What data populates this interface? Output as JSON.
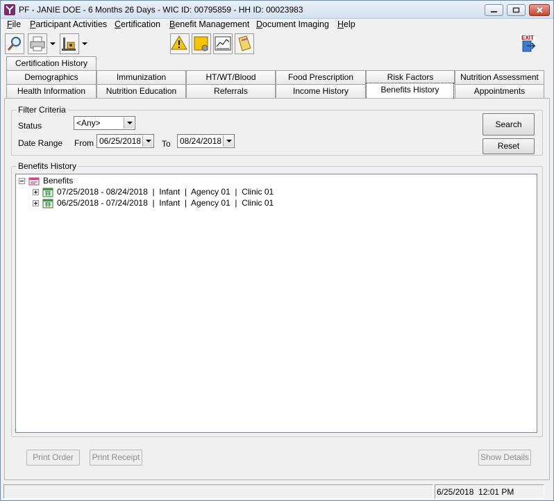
{
  "window": {
    "title": "PF - JANIE DOE - 6 Months 26 Days - WIC ID: 00795859 - HH ID: 00023983",
    "controls": [
      "minimize",
      "maximize",
      "close"
    ]
  },
  "menu": {
    "items": [
      {
        "label": "File",
        "mnemonic": "F",
        "rest": "ile"
      },
      {
        "label": "Participant Activities",
        "mnemonic": "P",
        "rest": "articipant Activities"
      },
      {
        "label": "Certification",
        "mnemonic": "C",
        "rest": "ertification"
      },
      {
        "label": "Benefit Management",
        "mnemonic": "B",
        "rest": "enefit Management"
      },
      {
        "label": "Document Imaging",
        "mnemonic": "D",
        "rest": "ocument Imaging"
      },
      {
        "label": "Help",
        "mnemonic": "H",
        "rest": "elp"
      }
    ]
  },
  "toolbar": {
    "icons": [
      "search-icon",
      "printer-icon",
      "scale-icon",
      "alert-icon",
      "note-icon",
      "growth-chart-icon",
      "document-icon",
      "exit-icon"
    ],
    "exit_label": "EXIT"
  },
  "tabs": {
    "row1": [
      "Certification History"
    ],
    "row2": [
      "Demographics",
      "Immunization",
      "HT/WT/Blood",
      "Food Prescription",
      "Risk Factors",
      "Nutrition Assessment"
    ],
    "row3": [
      "Health Information",
      "Nutrition Education",
      "Referrals",
      "Income History",
      "Benefits History",
      "Appointments"
    ],
    "active": "Benefits History"
  },
  "filter": {
    "legend": "Filter Criteria",
    "status_label": "Status",
    "status_value": "<Any>",
    "date_range_label": "Date Range",
    "from_label": "From",
    "from_value": "06/25/2018",
    "to_label": "To",
    "to_value": "08/24/2018",
    "search_label": "Search",
    "reset_label": "Reset"
  },
  "history": {
    "legend": "Benefits History",
    "root_label": "Benefits",
    "rows": [
      {
        "text": "07/25/2018 - 08/24/2018  |  Infant  |  Agency 01  |  Clinic 01"
      },
      {
        "text": "06/25/2018 - 07/24/2018  |  Infant  |  Agency 01  |  Clinic 01"
      }
    ]
  },
  "actions": {
    "print_order": "Print Order",
    "print_receipt": "Print Receipt",
    "show_details": "Show Details"
  },
  "status": {
    "datetime": "6/25/2018  12:01 PM"
  }
}
